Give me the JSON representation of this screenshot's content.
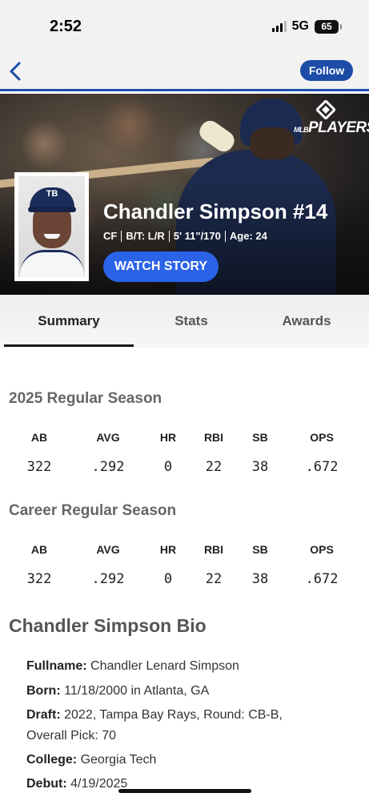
{
  "status_bar": {
    "time": "2:52",
    "network": "5G",
    "battery": "65"
  },
  "nav": {
    "back_icon": "chevron-left-icon",
    "follow_label": "Follow",
    "accent_color": "#1d4ba8"
  },
  "hero": {
    "logo_text": "PLAYERS",
    "logo_prefix": "MLB",
    "headshot_cap_logo": "TB",
    "player_name": "Chandler Simpson #14",
    "position": "CF",
    "bats_throws": "B/T: L/R",
    "height_weight": "5' 11\"/170",
    "age": "Age: 24",
    "watch_label": "WATCH STORY",
    "watch_color": "#2a63e8"
  },
  "tabs": [
    {
      "label": "Summary",
      "active": true
    },
    {
      "label": "Stats",
      "active": false
    },
    {
      "label": "Awards",
      "active": false
    }
  ],
  "season": {
    "title": "2025 Regular Season",
    "headers": [
      "AB",
      "AVG",
      "HR",
      "RBI",
      "SB",
      "OPS"
    ],
    "values": [
      "322",
      ".292",
      "0",
      "22",
      "38",
      ".672"
    ]
  },
  "career": {
    "title": "Career Regular Season",
    "headers": [
      "AB",
      "AVG",
      "HR",
      "RBI",
      "SB",
      "OPS"
    ],
    "values": [
      "322",
      ".292",
      "0",
      "22",
      "38",
      ".672"
    ]
  },
  "bio": {
    "title": "Chandler Simpson Bio",
    "fullname_label": "Fullname:",
    "fullname": "Chandler Lenard Simpson",
    "born_label": "Born:",
    "born": "11/18/2000 in Atlanta, GA",
    "draft_label": "Draft:",
    "draft_line1": "2022, Tampa Bay Rays, Round: CB-B,",
    "draft_line2": "Overall Pick: 70",
    "college_label": "College:",
    "college": "Georgia Tech",
    "debut_label": "Debut:",
    "debut": "4/19/2025"
  }
}
